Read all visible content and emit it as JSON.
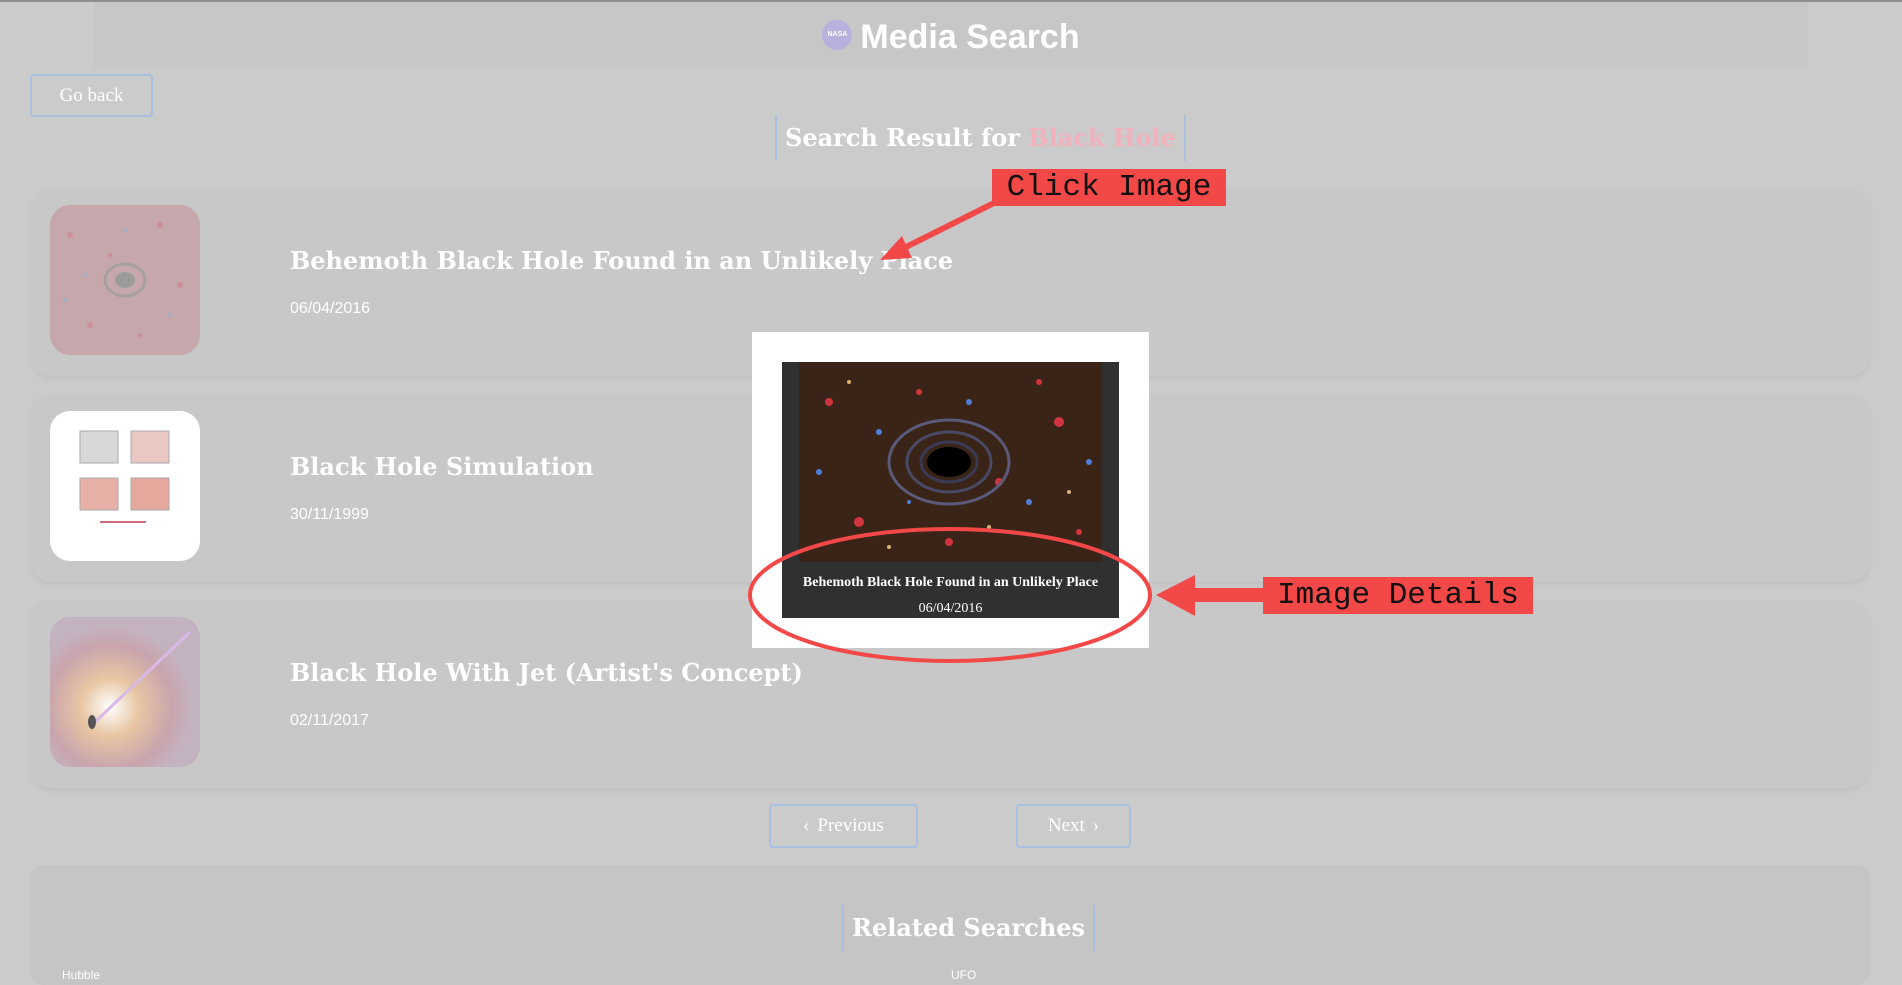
{
  "header": {
    "logo_text": "NASA",
    "title": "Media Search"
  },
  "nav": {
    "back_label": "Go back"
  },
  "search": {
    "prefix": "Search Result for ",
    "term": "Black Hole"
  },
  "results": [
    {
      "title": "Behemoth Black Hole Found in an Unlikely Place",
      "date": "06/04/2016"
    },
    {
      "title": "Black Hole Simulation",
      "date": "30/11/1999"
    },
    {
      "title": "Black Hole With Jet (Artist's Concept)",
      "date": "02/11/2017"
    }
  ],
  "pagination": {
    "previous_label": "Previous",
    "next_label": "Next"
  },
  "related": {
    "title": "Related Searches",
    "items": [
      "Hubble",
      "UFO"
    ]
  },
  "modal": {
    "title": "Behemoth Black Hole Found in an Unlikely Place",
    "date": "06/04/2016"
  },
  "annotations": {
    "click_image": "Click Image",
    "image_details": "Image Details"
  },
  "colors": {
    "background": "#cbcbcb",
    "accent_red": "#f24848",
    "button_border": "#a9bfdf",
    "search_term": "#f2b2bd"
  }
}
